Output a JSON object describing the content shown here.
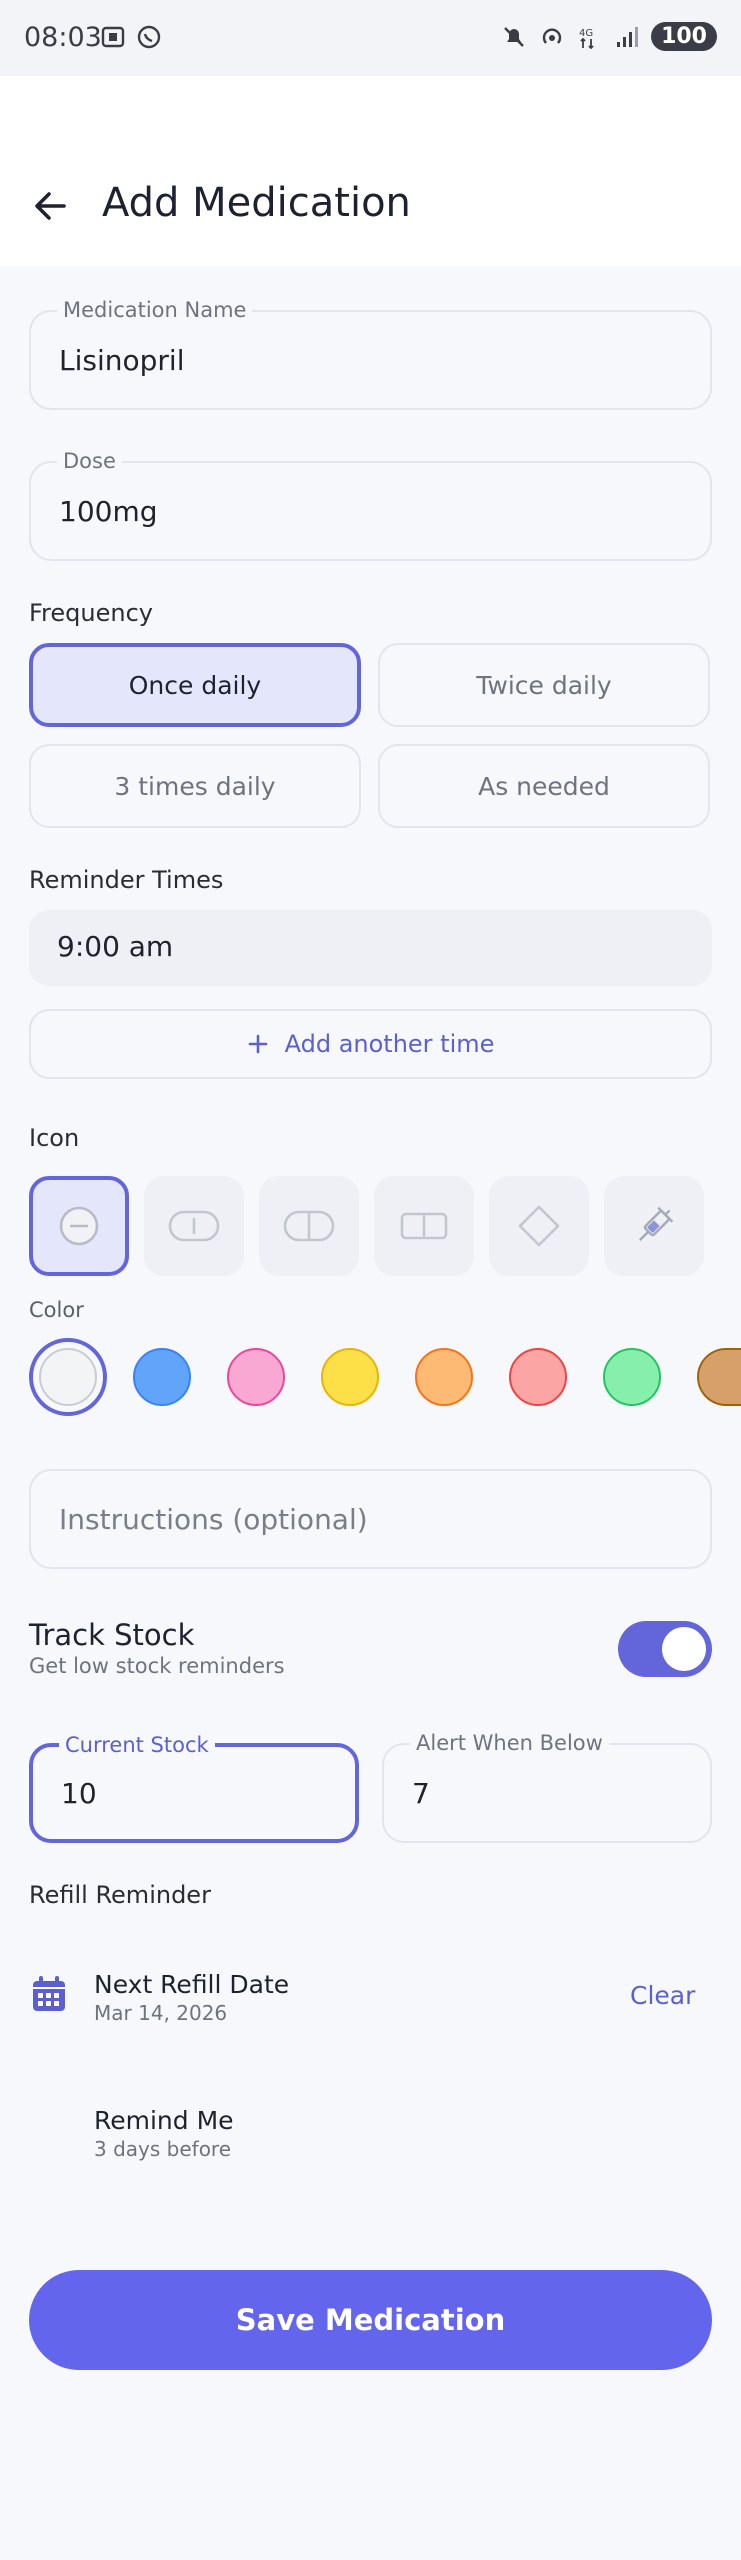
{
  "status_bar": {
    "time": "08:03",
    "battery": "100"
  },
  "header": {
    "title": "Add Medication",
    "back_icon": "arrow-left-icon"
  },
  "form": {
    "medication_name": {
      "label": "Medication Name",
      "value": "Lisinopril"
    },
    "dose": {
      "label": "Dose",
      "value": "100mg"
    },
    "frequency": {
      "label": "Frequency",
      "options": [
        "Once daily",
        "Twice daily",
        "3 times daily",
        "As needed"
      ],
      "selected": "Once daily"
    },
    "reminder_times": {
      "label": "Reminder Times",
      "times": [
        "9:00 am"
      ],
      "add_label": "Add another time"
    },
    "icon": {
      "label": "Icon",
      "options": [
        "round-pill-icon",
        "oval-pill-icon",
        "capsule-icon",
        "tablet-icon",
        "diamond-pill-icon",
        "syringe-icon"
      ],
      "selected": "round-pill-icon"
    },
    "color": {
      "label": "Color",
      "options": [
        "#f3f4f6",
        "#60a5fa",
        "#f9a8d4",
        "#fde047",
        "#fdba74",
        "#fca5a5",
        "#86efac",
        "#d6a06b"
      ],
      "selected": "#f3f4f6"
    },
    "instructions": {
      "placeholder": "Instructions (optional)"
    },
    "track_stock": {
      "title": "Track Stock",
      "subtitle": "Get low stock reminders",
      "enabled": true
    },
    "current_stock": {
      "label": "Current Stock",
      "value": "10"
    },
    "alert_below": {
      "label": "Alert When Below",
      "value": "7"
    },
    "refill": {
      "label": "Refill Reminder",
      "next_date_title": "Next Refill Date",
      "next_date_value": "Mar 14, 2026",
      "clear_label": "Clear",
      "remind_title": "Remind Me",
      "remind_value": "3 days before"
    }
  },
  "save_label": "Save Medication",
  "colors": {
    "accent": "#6366d8",
    "button": "#6366ec"
  }
}
